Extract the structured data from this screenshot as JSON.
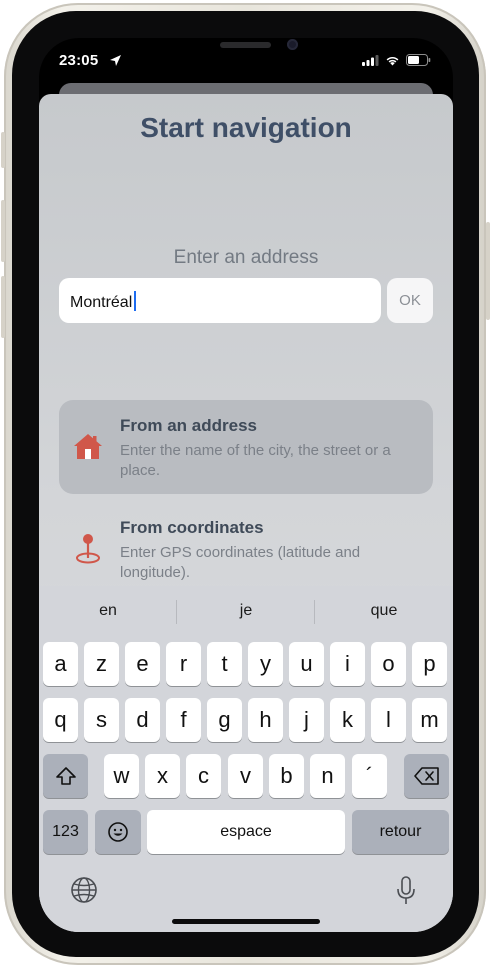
{
  "status_bar": {
    "time": "23:05",
    "icons": [
      "location-arrow-icon",
      "signal-icon",
      "wifi-icon",
      "battery-icon"
    ]
  },
  "header": {
    "title": "Start navigation"
  },
  "address_form": {
    "label": "Enter an address",
    "value": "Montréal",
    "ok_label": "OK"
  },
  "options": [
    {
      "title": "From an address",
      "description": "Enter the name of the city, the street or a place.",
      "icon": "house-icon",
      "selected": true
    },
    {
      "title": "From coordinates",
      "description": "Enter GPS coordinates (latitude and longitude).",
      "icon": "map-pin-icon",
      "selected": false
    }
  ],
  "keyboard": {
    "suggestions": [
      "en",
      "je",
      "que"
    ],
    "row1": [
      "a",
      "z",
      "e",
      "r",
      "t",
      "y",
      "u",
      "i",
      "o",
      "p"
    ],
    "row2": [
      "q",
      "s",
      "d",
      "f",
      "g",
      "h",
      "j",
      "k",
      "l",
      "m"
    ],
    "row3": [
      "w",
      "x",
      "c",
      "v",
      "b",
      "n",
      "´"
    ],
    "numbers_label": "123",
    "space_label": "espace",
    "return_label": "retour",
    "icons": [
      "shift-icon",
      "delete-icon",
      "emoji-icon",
      "globe-icon",
      "microphone-icon"
    ]
  },
  "colors": {
    "accent": "#d0574a",
    "title": "#3f4f67",
    "caret": "#1d6cf0"
  }
}
